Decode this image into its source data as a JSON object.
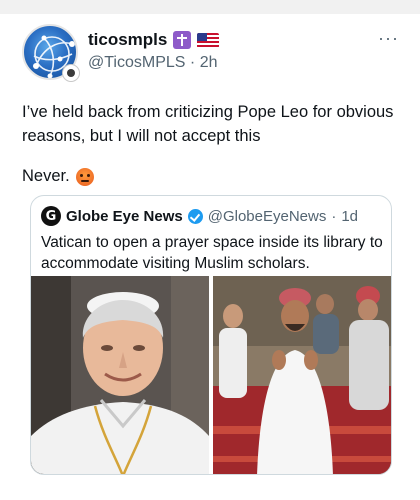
{
  "user": {
    "name": "ticosmpls",
    "name_emojis": [
      "latin-cross-emoji",
      "us-flag-emoji"
    ],
    "handle": "@TicosMPLS",
    "separator": "·",
    "time": "2h"
  },
  "more_label": "···",
  "tweet": {
    "text_line1": "I’ve held back from criticizing Pope Leo for obvious",
    "text_line2": "reasons, but I will not accept this",
    "text_line3": "Never.",
    "emoji": "angry-face-emoji"
  },
  "quote": {
    "logo_letter": "G",
    "name": "Globe Eye News",
    "verified": true,
    "handle": "@GlobeEyeNews",
    "separator": "·",
    "time": "1d",
    "text_line1": "Vatican to open a prayer space inside its library to",
    "text_line2": "accommodate visiting Muslim scholars.",
    "images": [
      "smiling-man-in-white-papal-cassock-photo",
      "men-praying-on-red-carpet-photo"
    ]
  },
  "colors": {
    "text": "#0f1419",
    "secondary": "#536471",
    "border": "#cfd9de",
    "verified": "#1d9bf0"
  }
}
